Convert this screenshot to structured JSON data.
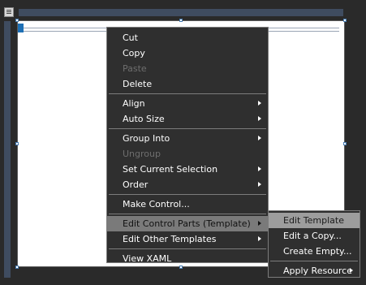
{
  "context_menu": {
    "items": [
      {
        "label": "Cut"
      },
      {
        "label": "Copy"
      },
      {
        "label": "Paste"
      },
      {
        "label": "Delete"
      },
      {
        "label": "Align"
      },
      {
        "label": "Auto Size"
      },
      {
        "label": "Group Into"
      },
      {
        "label": "Ungroup"
      },
      {
        "label": "Set Current Selection"
      },
      {
        "label": "Order"
      },
      {
        "label": "Make Control..."
      },
      {
        "label": "Edit Control Parts (Template)"
      },
      {
        "label": "Edit Other Templates"
      },
      {
        "label": "View XAML"
      }
    ]
  },
  "submenu": {
    "items": [
      {
        "label": "Edit Template"
      },
      {
        "label": "Edit a Copy..."
      },
      {
        "label": "Create Empty..."
      },
      {
        "label": "Apply Resource"
      }
    ]
  },
  "colors": {
    "menu_bg": "#2f2f2f",
    "highlight": "#9d9d9d",
    "ruler": "#3f4c60",
    "selection_marker": "#1d6fb4"
  }
}
